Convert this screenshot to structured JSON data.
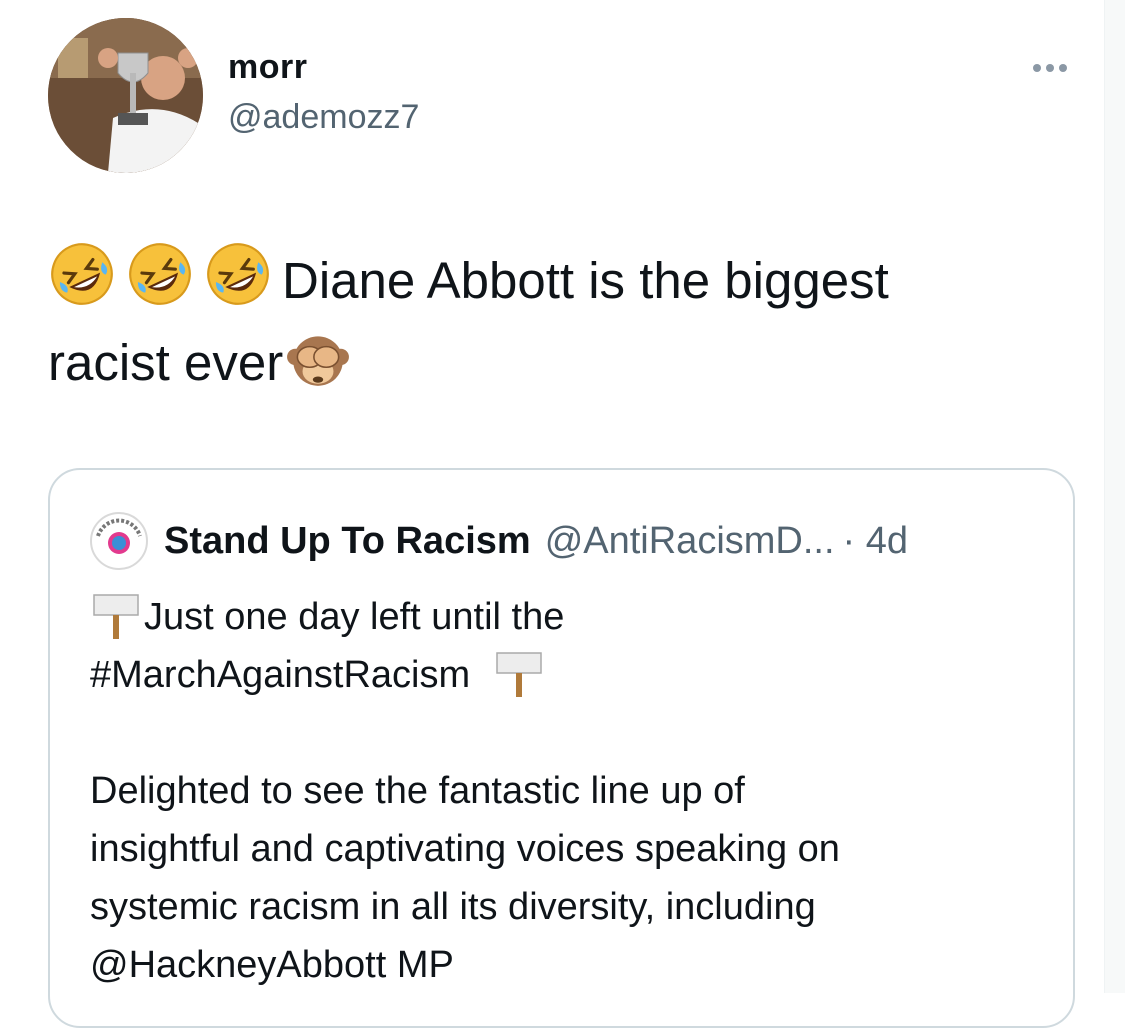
{
  "author": {
    "name": "morr",
    "handle": "@ademozz7",
    "avatar_desc": "avatar"
  },
  "more_menu_icon": "more-horizontal-icon",
  "tweet": {
    "emoji_prefix": [
      "rolling-on-floor-laughing",
      "rolling-on-floor-laughing",
      "rolling-on-floor-laughing"
    ],
    "text_line1": "Diane Abbott is the biggest",
    "text_line2": "racist ever",
    "emoji_suffix": "see-no-evil-monkey"
  },
  "quoted": {
    "name": "Stand Up To Racism",
    "handle": "@AntiRacismD...",
    "time": "· 4d",
    "line1": "Just one day left until the",
    "line2": "#MarchAgainstRacism",
    "para2_line1": "Delighted to see the fantastic line up of",
    "para2_line2": "insightful and captivating voices speaking on",
    "para2_line3": "systemic racism in all its diversity, including",
    "para2_line4": "@HackneyAbbott MP"
  },
  "colors": {
    "text": "#0f1419",
    "secondary": "#536471",
    "border": "#cfd9de"
  }
}
